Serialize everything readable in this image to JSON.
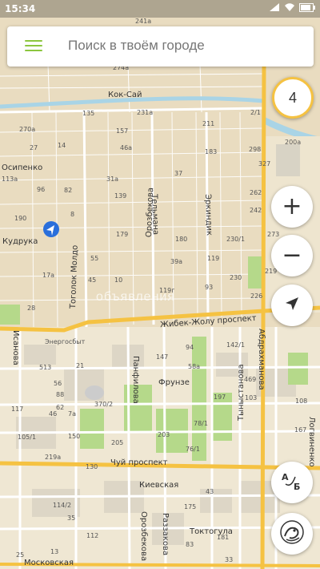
{
  "status_bar": {
    "time": "15:34",
    "battery": ""
  },
  "search": {
    "placeholder": "Поиск в твоём городе"
  },
  "zoom": {
    "level": "4"
  },
  "controls": {
    "zoom_in": "+",
    "zoom_out": "−"
  },
  "watermark": "объявления",
  "colors": {
    "map_bg": "#e9dcc0",
    "river": "#a9d4e6",
    "road_major": "#f5c242",
    "road_minor": "#ffffff",
    "park": "#b5d98a",
    "accent_green": "#8cc63f",
    "location_blue": "#2a6fdb"
  },
  "map": {
    "streets": [
      "Кок-Сай",
      "Осипенко",
      "Кудрука",
      "Тоголок Молдо",
      "Орозбекова",
      "Тельмана",
      "Эркиндик",
      "Жибек-Жолу проспект",
      "Исанова",
      "Энергосбыт",
      "Панфилова",
      "Фрунзе",
      "Абдрахманова",
      "Тыныстанова",
      "Чуй проспект",
      "Киевская",
      "Раззакова",
      "Токтогула",
      "Московская",
      "Логвиненко",
      "Орозбекова"
    ],
    "buildings": [
      "241a",
      "274a",
      "135",
      "231a",
      "2/1",
      "270a",
      "157",
      "211",
      "27",
      "14",
      "46a",
      "183",
      "298",
      "200a",
      "113a",
      "96",
      "82",
      "37",
      "327",
      "31a",
      "262",
      "190",
      "8",
      "139",
      "242",
      "179",
      "230/1",
      "273",
      "55",
      "180",
      "119",
      "17a",
      "45",
      "39a",
      "230",
      "219",
      "28",
      "10",
      "119г",
      "93",
      "226",
      "94",
      "142/1",
      "147",
      "58a",
      "513",
      "21",
      "56",
      "88",
      "62",
      "469",
      "103",
      "108",
      "117",
      "46",
      "7a",
      "370/2",
      "197",
      "105/1",
      "78/1",
      "150",
      "203",
      "205",
      "167",
      "219a",
      "76/1",
      "130",
      "114/2",
      "43",
      "175",
      "35",
      "112",
      "181",
      "83",
      "13",
      "25",
      "33"
    ]
  }
}
